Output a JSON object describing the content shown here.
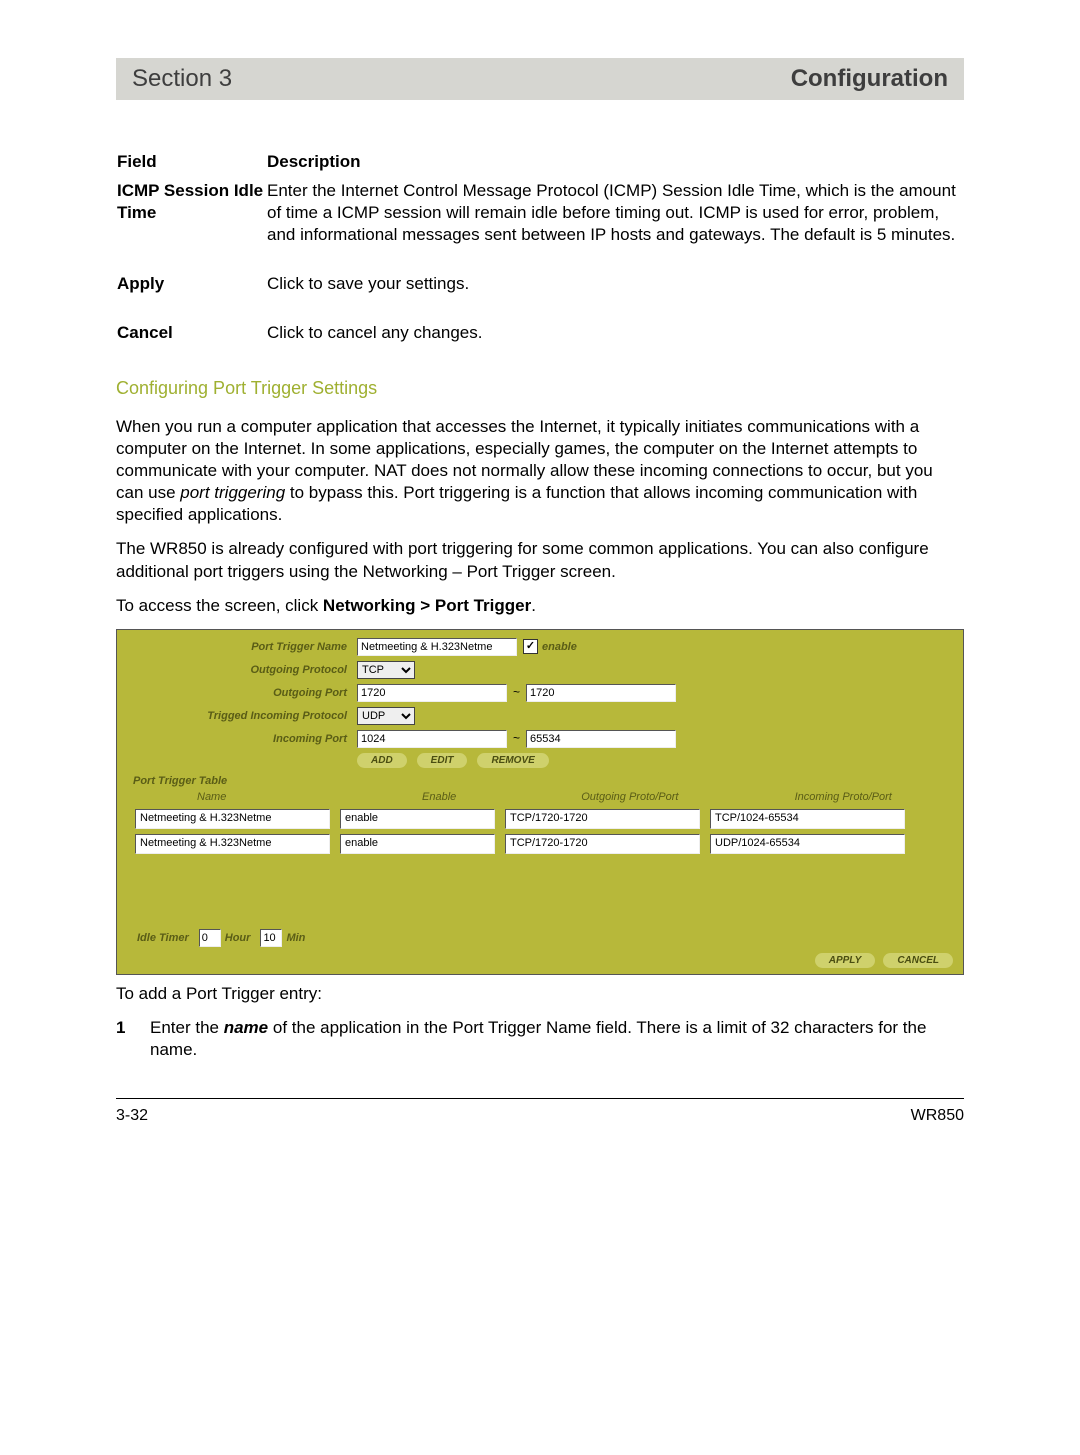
{
  "header": {
    "left": "Section 3",
    "right": "Configuration"
  },
  "fieldTable": {
    "headField": "Field",
    "headDesc": "Description",
    "rows": [
      {
        "field": "ICMP Session Idle Time",
        "desc": "Enter the Internet Control Message Protocol (ICMP) Session Idle Time, which is the amount of time a ICMP session will remain idle before timing out. ICMP is used for error, problem, and informational messages sent between IP hosts and gateways. The default is 5 minutes."
      },
      {
        "field": "Apply",
        "desc": "Click to save your settings."
      },
      {
        "field": "Cancel",
        "desc": "Click to cancel any changes."
      }
    ]
  },
  "subhead": "Configuring Port Trigger Settings",
  "para1_a": "When you run a computer application that accesses the Internet, it typically initiates communications with a computer on the Internet. In some applications, especially games, the computer on the Internet attempts to communicate with your computer. NAT does not normally allow these incoming connections to occur, but you can use ",
  "para1_em": "port triggering",
  "para1_b": " to bypass this. Port triggering is a function that allows incoming communication with specified applications.",
  "para2": "The WR850 is already configured with port triggering for some common applications. You can also configure additional port triggers using the Networking – Port Trigger screen.",
  "para3_a": "To access the screen, click ",
  "para3_b": "Networking > Port Trigger",
  "para3_c": ".",
  "form": {
    "labels": {
      "name": "Port Trigger Name",
      "outProto": "Outgoing Protocol",
      "outPort": "Outgoing Port",
      "inProto": "Trigged Incoming Protocol",
      "inPort": "Incoming Port",
      "enable": "enable"
    },
    "values": {
      "name": "Netmeeting & H.323Netme",
      "outProto": "TCP",
      "outPortFrom": "1720",
      "outPortTo": "1720",
      "inProto": "UDP",
      "inPortFrom": "1024",
      "inPortTo": "65534",
      "enableChecked": "✓"
    },
    "buttons": {
      "add": "ADD",
      "edit": "EDIT",
      "remove": "REMOVE"
    }
  },
  "triggerTable": {
    "title": "Port Trigger Table",
    "cols": {
      "name": "Name",
      "enable": "Enable",
      "out": "Outgoing Proto/Port",
      "in": "Incoming Proto/Port"
    },
    "rows": [
      {
        "name": "Netmeeting & H.323Netme",
        "enable": "enable",
        "out": "TCP/1720-1720",
        "in": "TCP/1024-65534"
      },
      {
        "name": "Netmeeting & H.323Netme",
        "enable": "enable",
        "out": "TCP/1720-1720",
        "in": "UDP/1024-65534"
      }
    ]
  },
  "idle": {
    "label": "Idle Timer",
    "hourVal": "0",
    "hourLabel": "Hour",
    "minVal": "10",
    "minLabel": "Min"
  },
  "footerButtons": {
    "apply": "APPLY",
    "cancel": "CANCEL"
  },
  "caption": "To add a Port Trigger entry:",
  "step1_num": "1",
  "step1_a": "Enter the ",
  "step1_em": "name",
  "step1_b": " of the application in the Port Trigger Name field. There is a limit of 32 characters for the name.",
  "footer": {
    "page": "3-32",
    "model": "WR850"
  }
}
